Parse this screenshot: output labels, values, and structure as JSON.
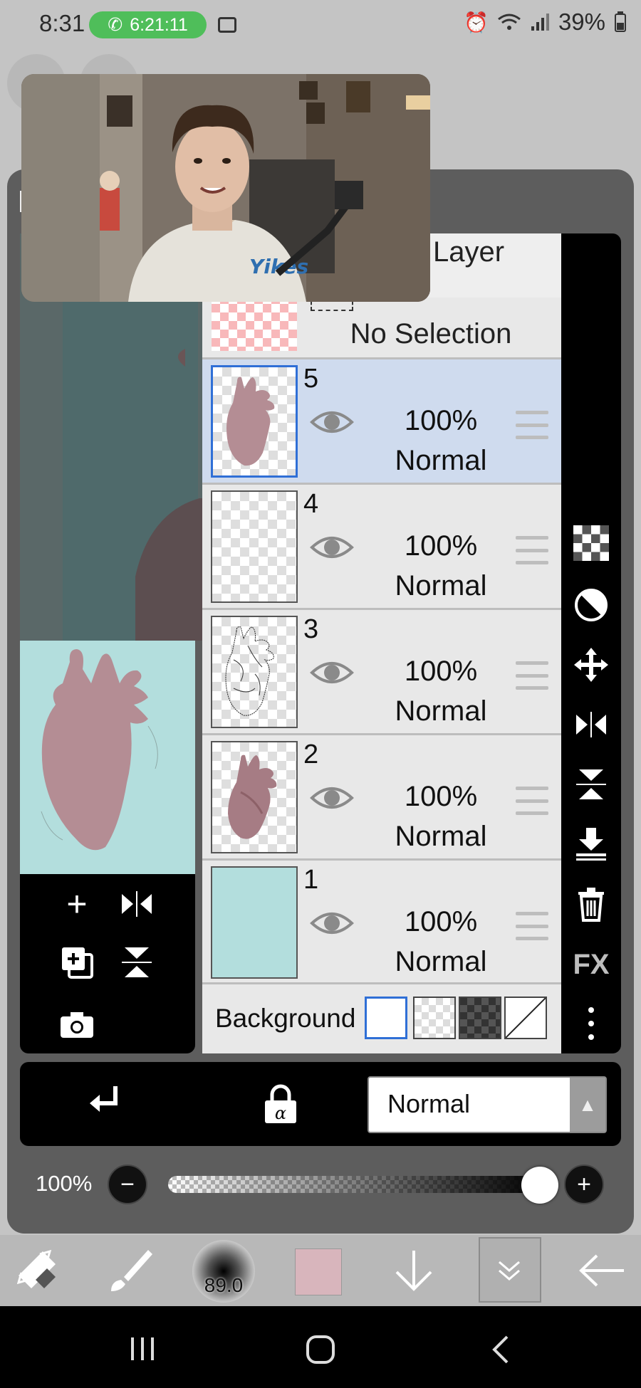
{
  "status_bar": {
    "time": "8:31",
    "call_timer": "6:21:11",
    "battery": "39%"
  },
  "layer_panel": {
    "title": "Layer",
    "selection_label": "No Selection",
    "layers": [
      {
        "number": "5",
        "opacity": "100%",
        "mode": "Normal",
        "visible": true,
        "selected": true
      },
      {
        "number": "4",
        "opacity": "100%",
        "mode": "Normal",
        "visible": true,
        "selected": false
      },
      {
        "number": "3",
        "opacity": "100%",
        "mode": "Normal",
        "visible": true,
        "selected": false
      },
      {
        "number": "2",
        "opacity": "100%",
        "mode": "Normal",
        "visible": true,
        "selected": false
      },
      {
        "number": "1",
        "opacity": "100%",
        "mode": "Normal",
        "visible": true,
        "selected": false
      }
    ],
    "background_label": "Background"
  },
  "right_tools": {
    "fx_label": "FX"
  },
  "blend": {
    "mode_value": "Normal"
  },
  "opacity": {
    "label": "100%",
    "value_fraction": 1.0
  },
  "toolbar": {
    "brush_size": "89.0",
    "color": "#d8b5bc"
  },
  "colors": {
    "selected_row": "#cfdbee",
    "selected_border": "#2f6fd6",
    "heart": "#b48d94",
    "layer1_fill": "#b3dedd",
    "call_green": "#4fbe5a"
  }
}
